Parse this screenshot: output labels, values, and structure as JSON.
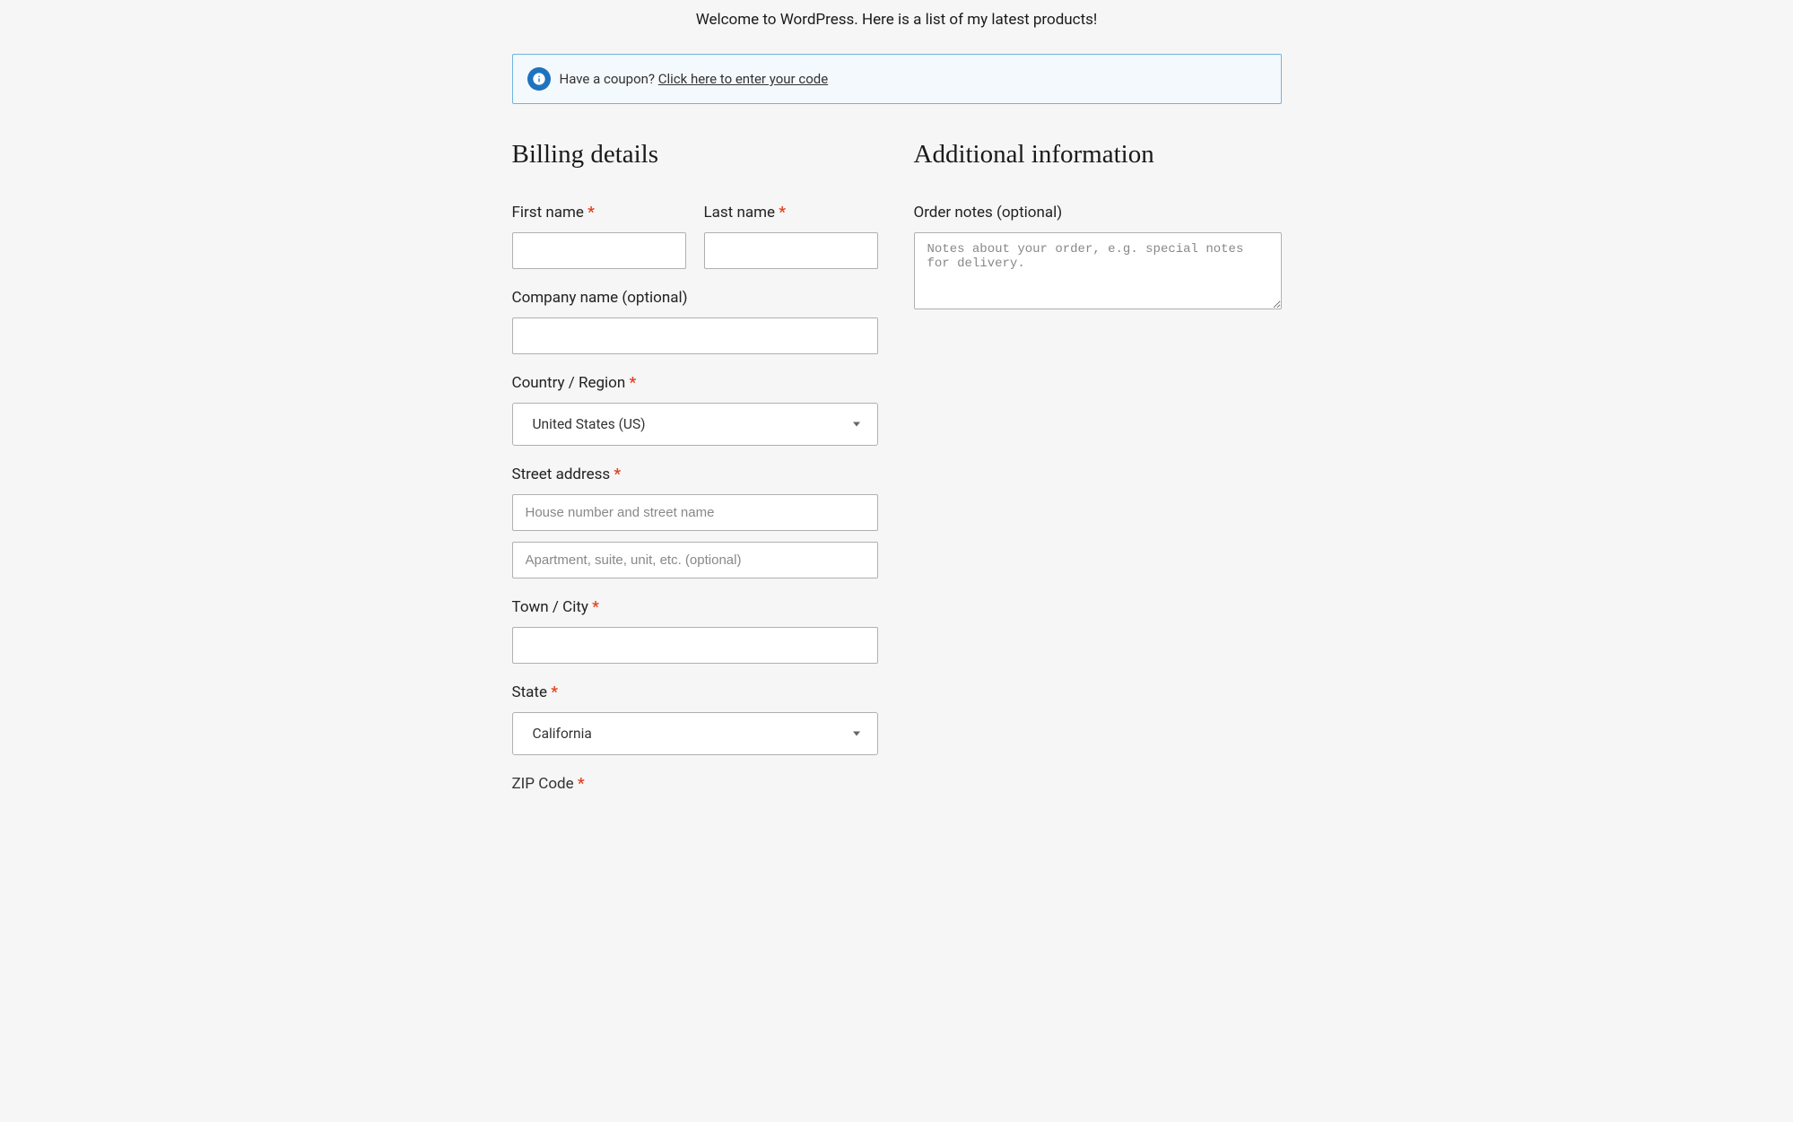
{
  "intro": "Welcome to WordPress. Here is a list of my latest products!",
  "coupon": {
    "prompt": "Have a coupon? ",
    "link_text": "Click here to enter your code"
  },
  "billing": {
    "heading": "Billing details",
    "first_name": {
      "label": "First name",
      "value": ""
    },
    "last_name": {
      "label": "Last name",
      "value": ""
    },
    "company": {
      "label": "Company name (optional)",
      "value": ""
    },
    "country": {
      "label": "Country / Region",
      "selected": "United States (US)"
    },
    "street": {
      "label": "Street address",
      "line1_placeholder": "House number and street name",
      "line1_value": "",
      "line2_placeholder": "Apartment, suite, unit, etc. (optional)",
      "line2_value": ""
    },
    "city": {
      "label": "Town / City",
      "value": ""
    },
    "state": {
      "label": "State",
      "selected": "California"
    },
    "zip": {
      "label": "ZIP Code"
    }
  },
  "additional": {
    "heading": "Additional information",
    "order_notes": {
      "label": "Order notes (optional)",
      "placeholder": "Notes about your order, e.g. special notes for delivery.",
      "value": ""
    }
  },
  "required_mark": "*"
}
